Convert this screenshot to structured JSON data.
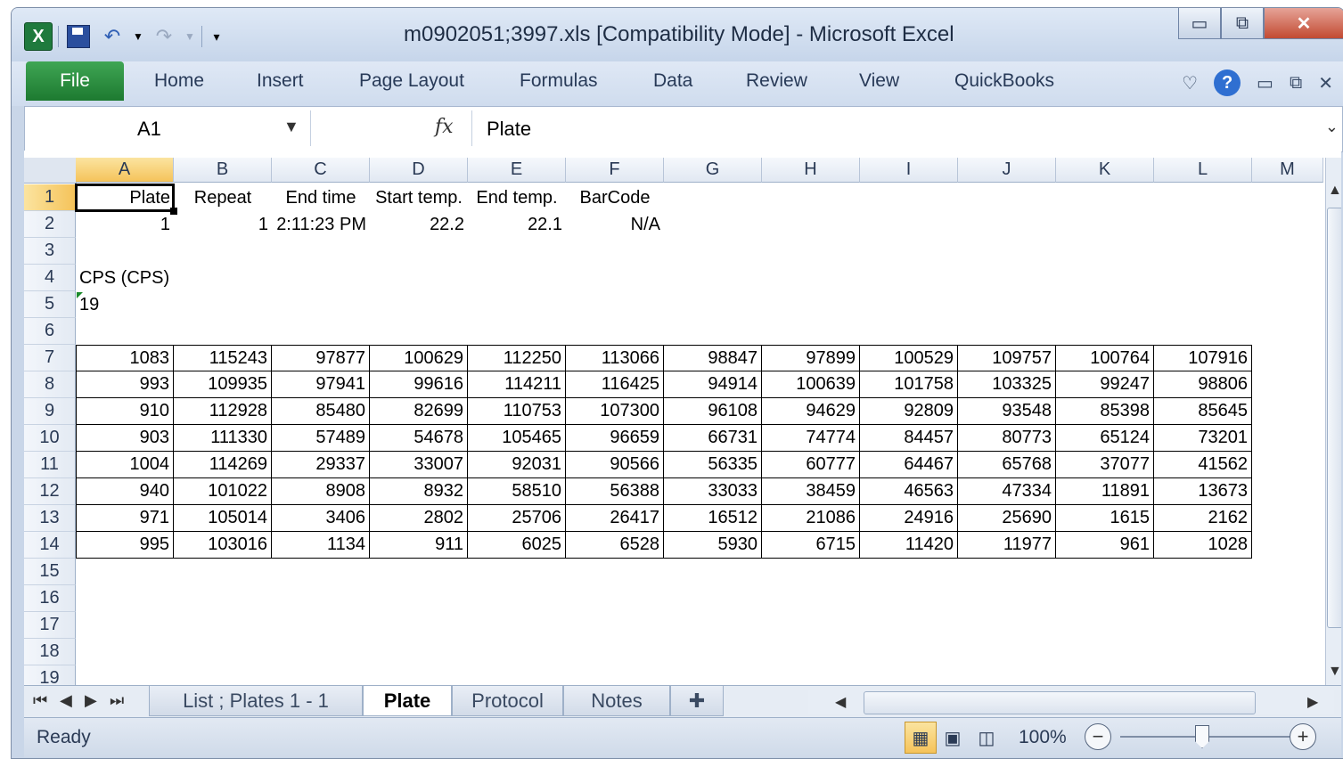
{
  "window": {
    "title": "m0902051;3997.xls  [Compatibility Mode]  -  Microsoft Excel",
    "app_icon": "X",
    "minimize_icon": "▭",
    "restore_icon": "⧉",
    "close_icon": "✕"
  },
  "ribbon": {
    "file_label": "File",
    "tabs": [
      "Home",
      "Insert",
      "Page Layout",
      "Formulas",
      "Data",
      "Review",
      "View",
      "QuickBooks"
    ]
  },
  "formula_bar": {
    "name_box": "A1",
    "fx_label": "fx",
    "content": "Plate"
  },
  "sheet": {
    "columns": [
      "A",
      "B",
      "C",
      "D",
      "E",
      "F",
      "G",
      "H",
      "I",
      "J",
      "K",
      "L",
      "M"
    ],
    "rows": [
      "1",
      "2",
      "3",
      "4",
      "5",
      "6",
      "7",
      "8",
      "9",
      "10",
      "11",
      "12",
      "13",
      "14",
      "15",
      "16",
      "17",
      "18",
      "19"
    ],
    "header_row": [
      "Plate",
      "Repeat",
      "End time",
      "Start temp.",
      "End temp.",
      "BarCode"
    ],
    "info_row": [
      "1",
      "1",
      "2:11:23 PM",
      "22.2",
      "22.1",
      "N/A"
    ],
    "label_a4": "CPS (CPS)",
    "value_a5": "19",
    "data": [
      [
        "1083",
        "115243",
        "97877",
        "100629",
        "112250",
        "113066",
        "98847",
        "97899",
        "100529",
        "109757",
        "100764",
        "107916"
      ],
      [
        "993",
        "109935",
        "97941",
        "99616",
        "114211",
        "116425",
        "94914",
        "100639",
        "101758",
        "103325",
        "99247",
        "98806"
      ],
      [
        "910",
        "112928",
        "85480",
        "82699",
        "110753",
        "107300",
        "96108",
        "94629",
        "92809",
        "93548",
        "85398",
        "85645"
      ],
      [
        "903",
        "111330",
        "57489",
        "54678",
        "105465",
        "96659",
        "66731",
        "74774",
        "84457",
        "80773",
        "65124",
        "73201"
      ],
      [
        "1004",
        "114269",
        "29337",
        "33007",
        "92031",
        "90566",
        "56335",
        "60777",
        "64467",
        "65768",
        "37077",
        "41562"
      ],
      [
        "940",
        "101022",
        "8908",
        "8932",
        "58510",
        "56388",
        "33033",
        "38459",
        "46563",
        "47334",
        "11891",
        "13673"
      ],
      [
        "971",
        "105014",
        "3406",
        "2802",
        "25706",
        "26417",
        "16512",
        "21086",
        "24916",
        "25690",
        "1615",
        "2162"
      ],
      [
        "995",
        "103016",
        "1134",
        "911",
        "6025",
        "6528",
        "5930",
        "6715",
        "11420",
        "11977",
        "961",
        "1028"
      ]
    ]
  },
  "sheet_tabs": [
    "List ; Plates 1 - 1",
    "Plate",
    "Protocol",
    "Notes"
  ],
  "active_sheet": "Plate",
  "status": {
    "text": "Ready",
    "zoom": "100%",
    "zoom_out": "−",
    "zoom_in": "+"
  }
}
